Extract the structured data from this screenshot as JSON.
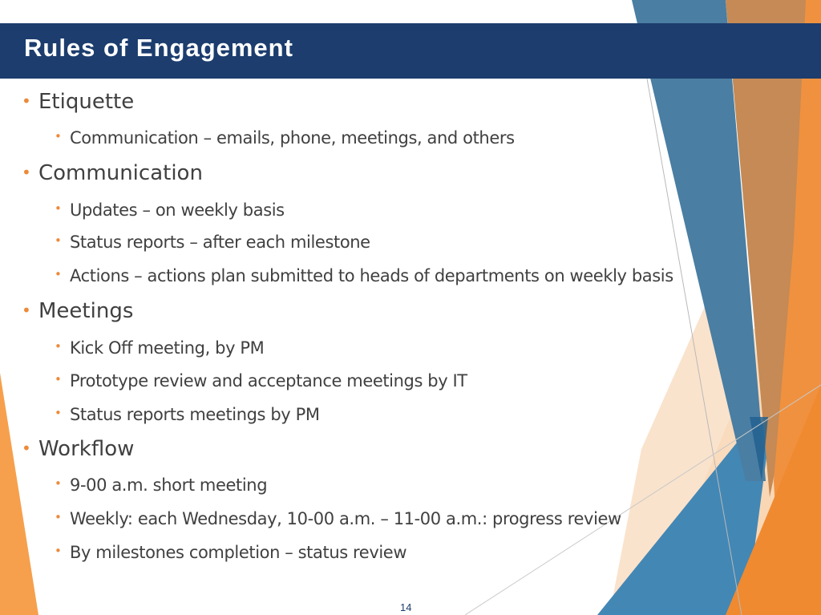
{
  "slide": {
    "title": "Rules of Engagement",
    "page_number": "14",
    "colors": {
      "title_bar": "#1c3d6e",
      "title_text": "#ffffff",
      "body_text": "#404040",
      "bullet": "#ed8a3a",
      "accent_blue": "#4a7ea3",
      "accent_orange": "#f08a30",
      "accent_peach": "#f8d3ad"
    },
    "sections": [
      {
        "heading": "Etiquette",
        "items": [
          "Communication – emails, phone, meetings, and others"
        ]
      },
      {
        "heading": "Communication",
        "items": [
          "Updates – on weekly basis",
          "Status reports – after each milestone",
          "Actions – actions plan submitted to heads of departments on weekly basis"
        ]
      },
      {
        "heading": "Meetings",
        "items": [
          "Kick Off meeting, by PM",
          "Prototype review and acceptance meetings by IT",
          "Status reports meetings by PM"
        ]
      },
      {
        "heading": "Workflow",
        "items": [
          "9-00 a.m. short meeting",
          "Weekly: each Wednesday, 10-00 a.m. – 11-00 a.m.: progress review",
          "By milestones completion – status review"
        ]
      }
    ],
    "bullet_glyph": "•"
  }
}
